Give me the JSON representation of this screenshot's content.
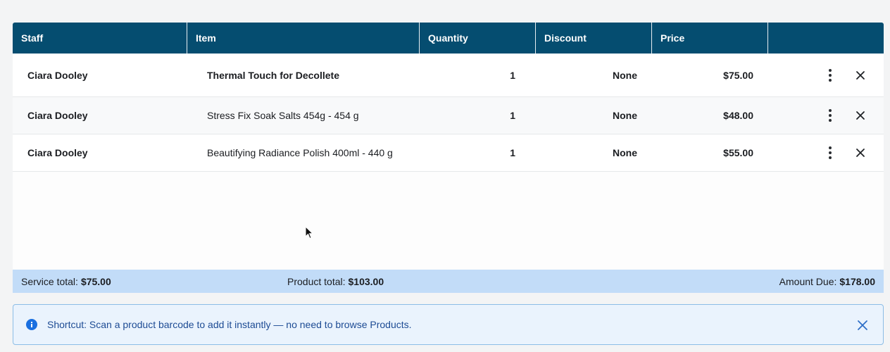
{
  "table": {
    "headers": [
      "Staff",
      "Item",
      "Quantity",
      "Discount",
      "Price",
      ""
    ],
    "rows": [
      {
        "staff": "Ciara Dooley",
        "item": "Thermal Touch for Decollete",
        "quantity": "1",
        "discount": "None",
        "price": "$75.00"
      },
      {
        "staff": "Ciara Dooley",
        "item": "Stress Fix Soak Salts 454g - 454 g",
        "quantity": "1",
        "discount": "None",
        "price": "$48.00"
      },
      {
        "staff": "Ciara Dooley",
        "item": "Beautifying Radiance Polish 400ml - 440 g",
        "quantity": "1",
        "discount": "None",
        "price": "$55.00"
      }
    ],
    "row_icons": {
      "more": "more-vertical-icon",
      "remove": "close-icon"
    }
  },
  "totals": {
    "service_label": "Service total:",
    "service_value": "$75.00",
    "product_label": "Product total:",
    "product_value": "$103.00",
    "due_label": "Amount Due:",
    "due_value": "$178.00"
  },
  "banner": {
    "icon": "info-icon",
    "text": "Shortcut: Scan a product barcode to add it instantly — no need to browse Products.",
    "close_icon": "close-icon"
  },
  "colors": {
    "header_bg": "#054d70",
    "totals_bg": "#c2dcf8",
    "banner_bg": "#eaf3fd",
    "banner_border": "#8cbde6",
    "banner_text": "#1d4b94",
    "info_icon": "#1a6fe0"
  }
}
